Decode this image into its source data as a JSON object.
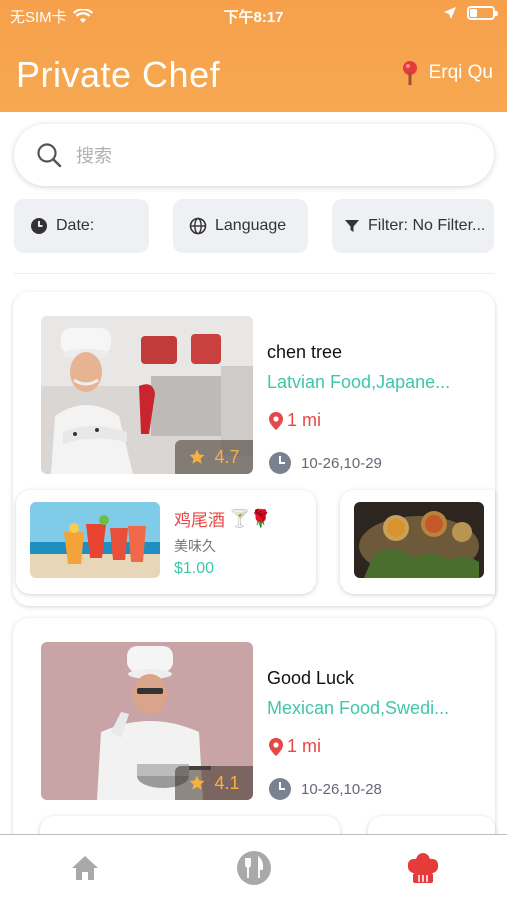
{
  "status_bar": {
    "carrier": "无SIM卡",
    "time": "下午8:17"
  },
  "header": {
    "title": "Private Chef",
    "location": "Erqi Qu"
  },
  "search": {
    "placeholder": "搜索"
  },
  "filters": [
    {
      "label": "Date:",
      "icon": "clock-icon"
    },
    {
      "label": "Language",
      "icon": "globe-icon"
    },
    {
      "label": "Filter: No Filter...",
      "icon": "funnel-icon"
    }
  ],
  "chefs": [
    {
      "name": "chen tree",
      "cuisine": "Latvian Food,Japane...",
      "distance": "1 mi",
      "dates": "10-26,10-29",
      "rating": "4.7",
      "dishes": [
        {
          "name": "鸡尾酒",
          "emoji": "🍸🌹",
          "subtitle": "美味久",
          "price": "$1.00"
        }
      ]
    },
    {
      "name": "Good Luck",
      "cuisine": "Mexican Food,Swedi...",
      "distance": "1 mi",
      "dates": "10-26,10-28",
      "rating": "4.1"
    }
  ],
  "tabbar": [
    {
      "icon": "home-icon",
      "active": false
    },
    {
      "icon": "fork-knife-icon",
      "active": false
    },
    {
      "icon": "chef-hat-icon",
      "active": true
    }
  ],
  "colors": {
    "header": "#f6a04c",
    "accent_red": "#e64848",
    "accent_green": "#3fc7a8",
    "star": "#f6b13f"
  }
}
